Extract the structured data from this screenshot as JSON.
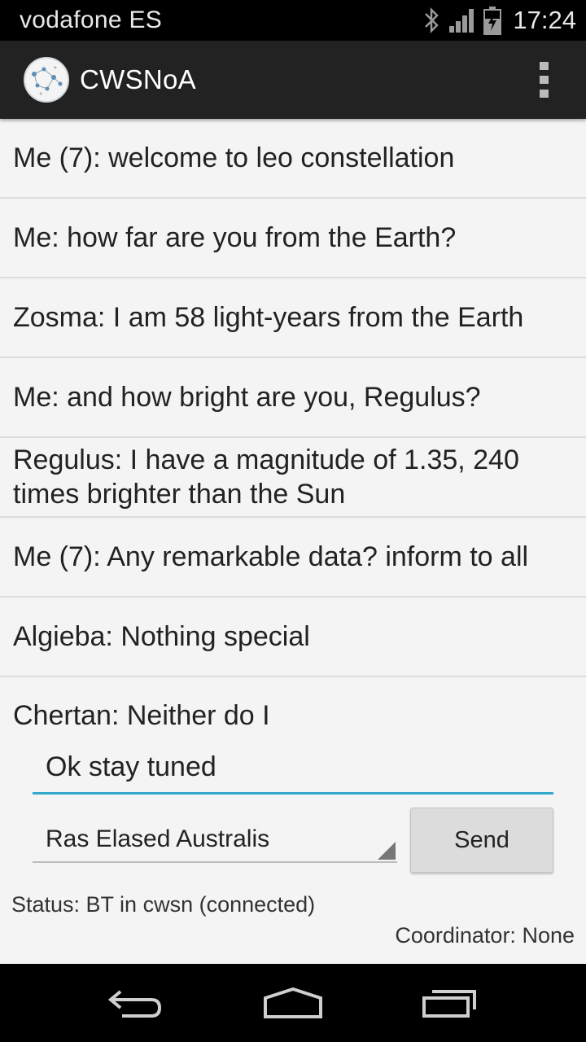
{
  "status_bar": {
    "carrier": "vodafone ES",
    "time": "17:24",
    "icons": [
      "bluetooth-icon",
      "signal-icon",
      "battery-charging-icon"
    ]
  },
  "action_bar": {
    "title": "CWSNoA",
    "logo_icon": "constellation-logo-icon",
    "overflow_icon": "overflow-menu-icon"
  },
  "messages": [
    "Me (7): welcome to leo constellation",
    "Me: how far are you from the Earth?",
    "Zosma: I am 58 light-years from the Earth",
    "Me: and how bright are you, Regulus?",
    "Regulus: I have a magnitude of 1.35, 240 times brighter than the Sun",
    "Me (7): Any remarkable data? inform to all",
    "Algieba: Nothing special",
    "Chertan: Neither do I"
  ],
  "compose": {
    "input_value": "Ok stay tuned",
    "recipient_selected": "Ras Elased Australis",
    "send_label": "Send"
  },
  "footer": {
    "status": "Status: BT in cwsn (connected)",
    "coordinator": "Coordinator: None"
  },
  "nav_bar": {
    "icons": [
      "back-icon",
      "home-icon",
      "recent-apps-icon"
    ]
  },
  "colors": {
    "action_bar": "#222222",
    "accent": "#33a8cc",
    "background": "#f4f4f4"
  }
}
